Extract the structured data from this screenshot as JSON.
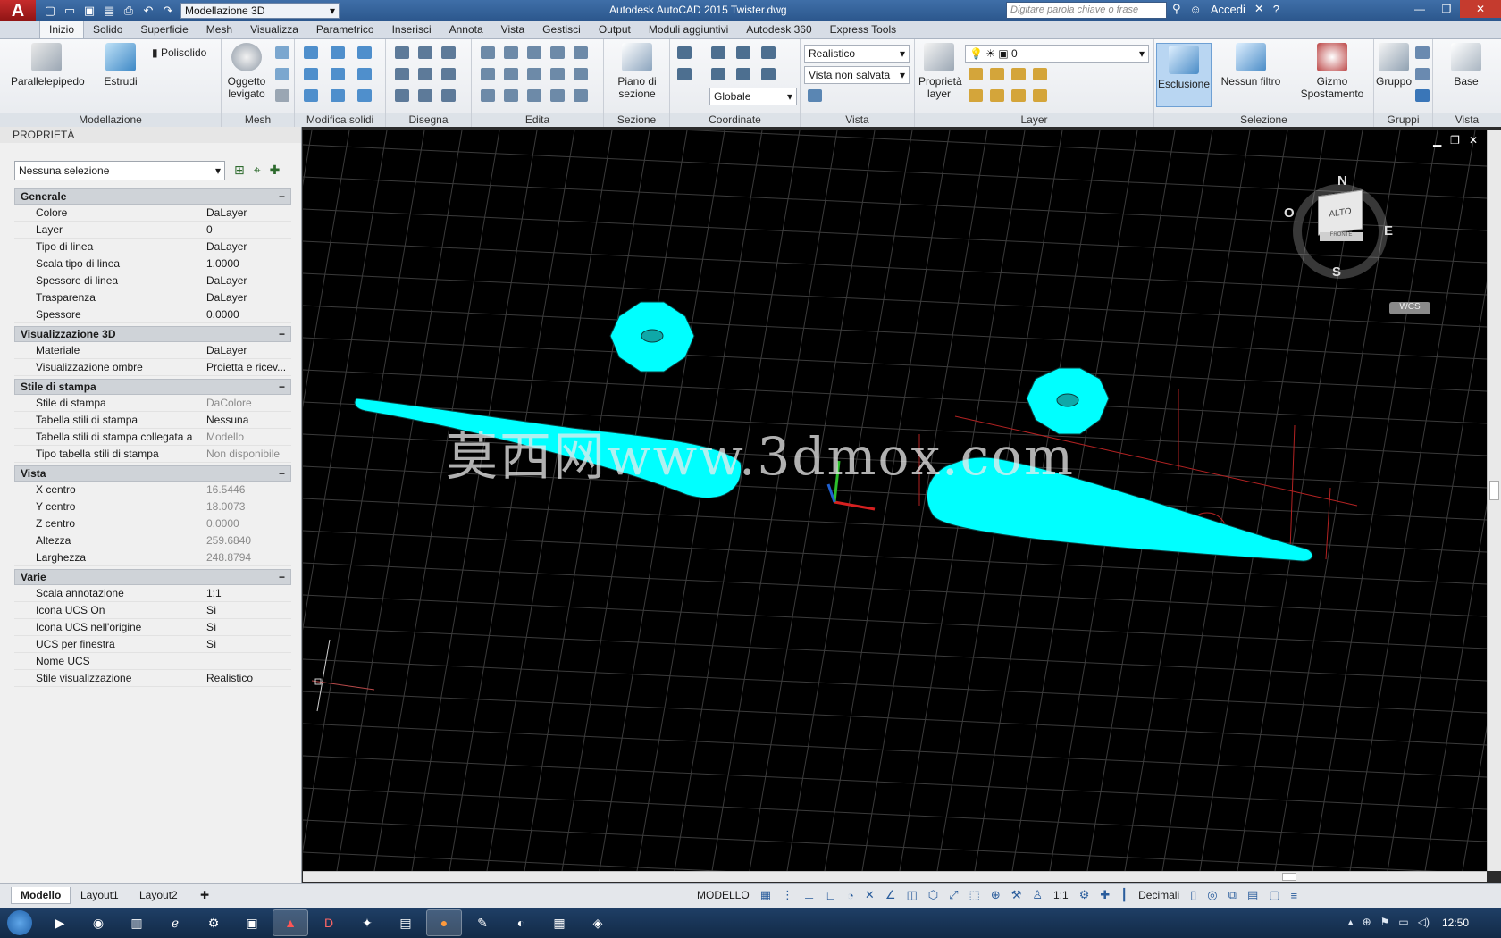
{
  "titlebar": {
    "app_letter": "A",
    "workspace": "Modellazione 3D",
    "title": "Autodesk AutoCAD 2015    Twister.dwg",
    "search_placeholder": "Digitare parola chiave o frase",
    "signin": "Accedi"
  },
  "tabs": [
    "Inizio",
    "Solido",
    "Superficie",
    "Mesh",
    "Visualizza",
    "Parametrico",
    "Inserisci",
    "Annota",
    "Vista",
    "Gestisci",
    "Output",
    "Moduli aggiuntivi",
    "Autodesk 360",
    "Express Tools"
  ],
  "ribbon": {
    "modellazione": {
      "title": "Modellazione",
      "parallelepipedo": "Parallelepipedo",
      "estrudi": "Estrudi",
      "polisolido": "Polisolido"
    },
    "mesh": {
      "title": "Mesh",
      "oggetto": "Oggetto",
      "levigato": "levigato"
    },
    "modifica_solidi": {
      "title": "Modifica solidi"
    },
    "disegna": {
      "title": "Disegna"
    },
    "edita": {
      "title": "Edita"
    },
    "sezione": {
      "title": "Sezione",
      "piano": "Piano di",
      "sezione": "sezione"
    },
    "coordinate": {
      "title": "Coordinate",
      "globale": "Globale"
    },
    "vista": {
      "title": "Vista",
      "stile": "Realistico",
      "vista": "Vista non salvata"
    },
    "layer": {
      "title": "Layer",
      "proprieta": "Proprietà",
      "layer_lbl": "layer",
      "current_layer": "0"
    },
    "selezione": {
      "title": "Selezione",
      "esclusione": "Esclusione",
      "nessun_filtro": "Nessun filtro",
      "gizmo": "Gizmo",
      "spostamento": "Spostamento"
    },
    "gruppi": {
      "title": "Gruppi",
      "gruppo": "Gruppo"
    },
    "vista2": {
      "title": "Vista",
      "base": "Base"
    }
  },
  "properties": {
    "header": "PROPRIETÀ",
    "selection": "Nessuna selezione",
    "sections": [
      {
        "title": "Generale",
        "rows": [
          {
            "k": "Colore",
            "v": "DaLayer"
          },
          {
            "k": "Layer",
            "v": "0"
          },
          {
            "k": "Tipo di linea",
            "v": "DaLayer"
          },
          {
            "k": "Scala tipo di linea",
            "v": "1.0000"
          },
          {
            "k": "Spessore di linea",
            "v": "DaLayer"
          },
          {
            "k": "Trasparenza",
            "v": "DaLayer"
          },
          {
            "k": "Spessore",
            "v": "0.0000"
          }
        ]
      },
      {
        "title": "Visualizzazione 3D",
        "rows": [
          {
            "k": "Materiale",
            "v": "DaLayer"
          },
          {
            "k": "Visualizzazione ombre",
            "v": "Proietta e ricev..."
          }
        ]
      },
      {
        "title": "Stile di stampa",
        "rows": [
          {
            "k": "Stile di stampa",
            "v": "DaColore"
          },
          {
            "k": "Tabella stili di stampa",
            "v": "Nessuna"
          },
          {
            "k": "Tabella stili di stampa collegata a",
            "v": "Modello"
          },
          {
            "k": "Tipo tabella stili di stampa",
            "v": "Non disponibile"
          }
        ]
      },
      {
        "title": "Vista",
        "rows": [
          {
            "k": "X centro",
            "v": "16.5446"
          },
          {
            "k": "Y centro",
            "v": "18.0073"
          },
          {
            "k": "Z centro",
            "v": "0.0000"
          },
          {
            "k": "Altezza",
            "v": "259.6840"
          },
          {
            "k": "Larghezza",
            "v": "248.8794"
          }
        ]
      },
      {
        "title": "Varie",
        "rows": [
          {
            "k": "Scala annotazione",
            "v": "1:1"
          },
          {
            "k": "Icona UCS On",
            "v": "Sì"
          },
          {
            "k": "Icona UCS nell'origine",
            "v": "Sì"
          },
          {
            "k": "UCS per finestra",
            "v": "Sì"
          },
          {
            "k": "Nome UCS",
            "v": ""
          },
          {
            "k": "Stile visualizzazione",
            "v": "Realistico"
          }
        ]
      }
    ]
  },
  "viewcube": {
    "top": "ALTO",
    "front": "FRONTE",
    "n": "N",
    "s": "S",
    "e": "E",
    "o": "O",
    "wcs": "WCS"
  },
  "watermark": "莫西网www.3dmox.com",
  "layout_tabs": [
    "Modello",
    "Layout1",
    "Layout2"
  ],
  "status": {
    "mode": "MODELLO",
    "scale": "1:1",
    "units": "Decimali"
  },
  "clock": "12:50",
  "colors": {
    "shape": "#00ffff",
    "grid": "#3a3a3a",
    "accent_red": "#c0392b"
  }
}
